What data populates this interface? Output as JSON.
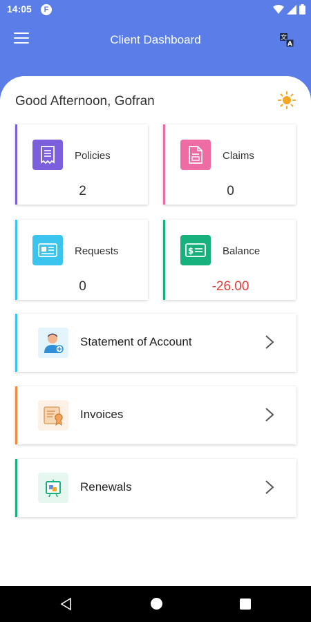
{
  "status_bar": {
    "time": "14:05",
    "notif_letter": "F"
  },
  "app_bar": {
    "title": "Client Dashboard"
  },
  "greeting": "Good Afternoon, Gofran",
  "cards": {
    "policies": {
      "label": "Policies",
      "value": "2",
      "accent": "#7b5fdc"
    },
    "claims": {
      "label": "Claims",
      "value": "0",
      "accent": "#ef6ba4"
    },
    "requests": {
      "label": "Requests",
      "value": "0",
      "accent": "#3bc5ee"
    },
    "balance": {
      "label": "Balance",
      "value": "-26.00",
      "accent": "#17b17e",
      "value_color": "#e53935"
    }
  },
  "rows": {
    "statement": {
      "label": "Statement of Account",
      "accent": "#3bc5ee"
    },
    "invoices": {
      "label": "Invoices",
      "accent": "#f08b3c"
    },
    "renewals": {
      "label": "Renewals",
      "accent": "#17b17e"
    }
  }
}
